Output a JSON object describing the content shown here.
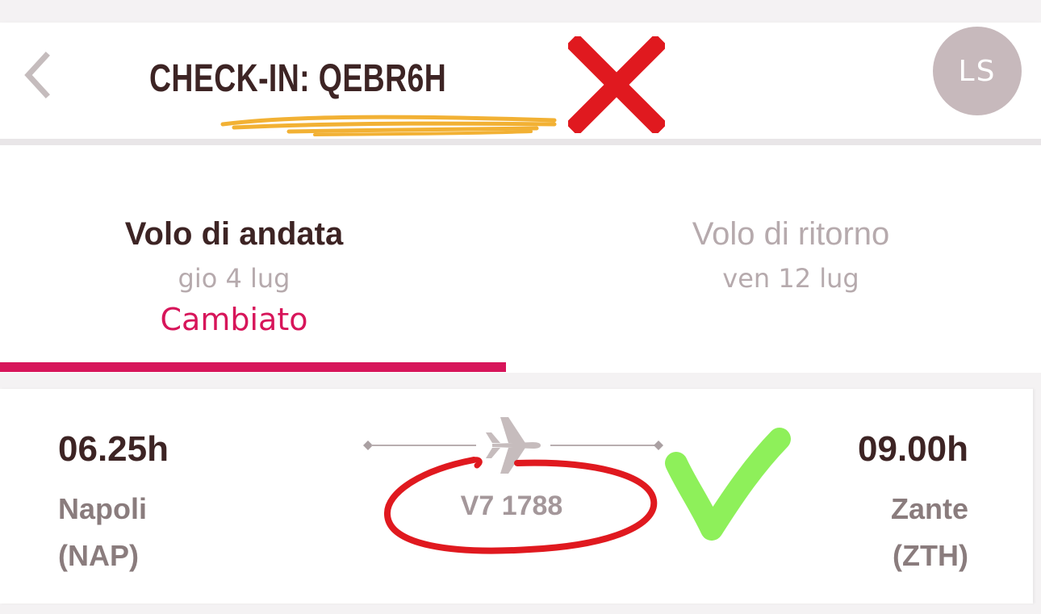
{
  "header": {
    "back_icon": "chevron-left-icon",
    "title": "CHECK-IN: QEBR6H",
    "avatar_initials": "LS"
  },
  "tabs": [
    {
      "id": "outbound",
      "title": "Volo di andata",
      "date": "gio 4 lug",
      "status": "Cambiato",
      "active": true
    },
    {
      "id": "return",
      "title": "Volo di ritorno",
      "date": "ven 12 lug",
      "active": false
    }
  ],
  "flight": {
    "departure": {
      "time": "06.25h",
      "city": "Napoli",
      "code": "(NAP)"
    },
    "arrival": {
      "time": "09.00h",
      "city": "Zante",
      "code": "(ZTH)"
    },
    "number": "V7 1788",
    "icon": "airplane-icon"
  },
  "colors": {
    "accent": "#d7155a",
    "text_dark": "#3d2424",
    "text_muted": "#b6aaad",
    "avatar_bg": "#c7b9bc",
    "annotation_red": "#e0191f",
    "annotation_green": "#8ef05a",
    "annotation_orange": "#f2b134"
  }
}
